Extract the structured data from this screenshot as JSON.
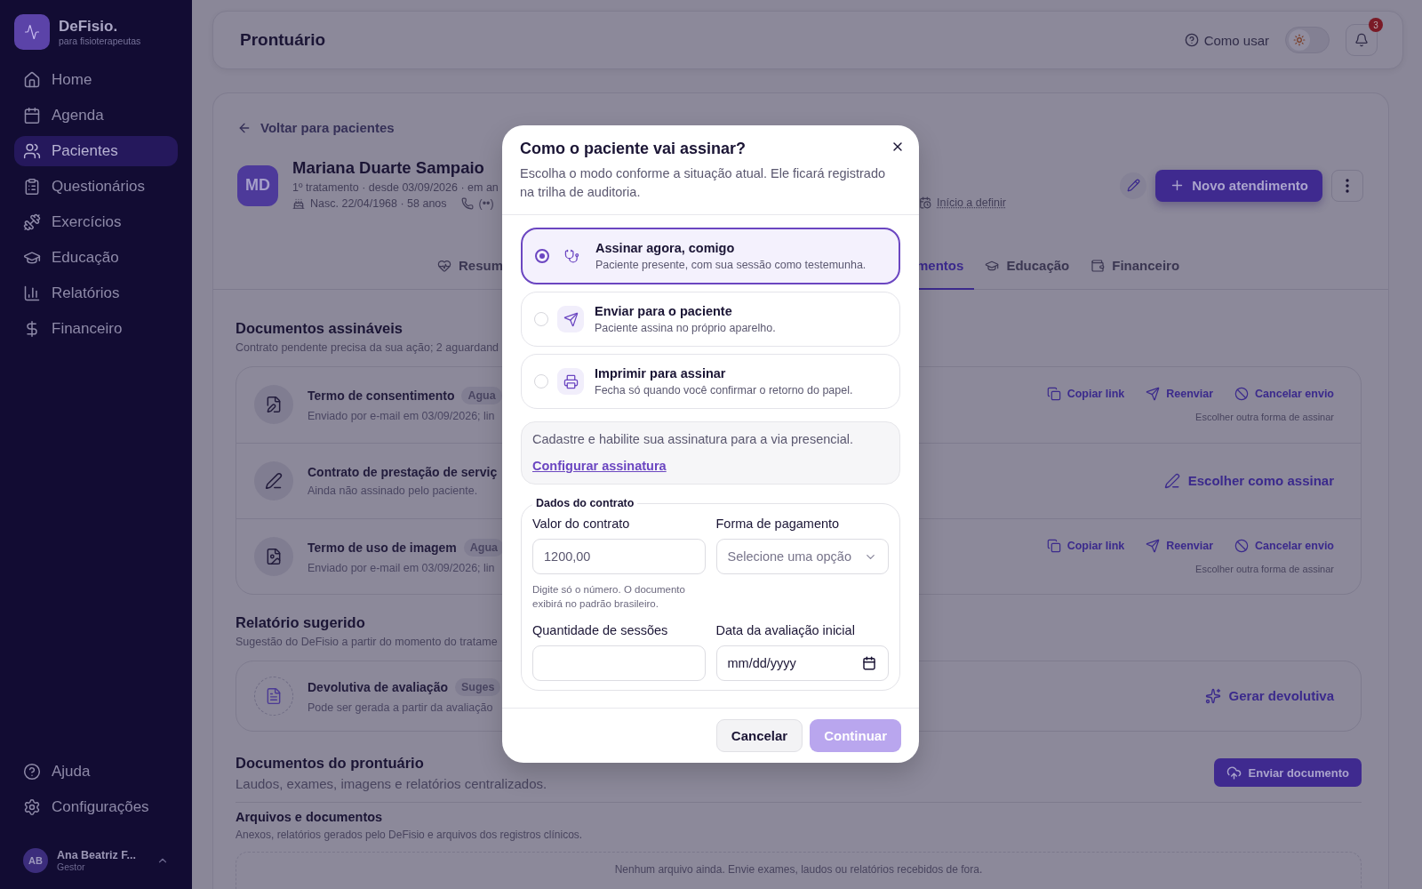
{
  "sidebar": {
    "brand": "DeFisio.",
    "tagline": "para fisioterapeutas",
    "items": [
      {
        "label": "Home",
        "selected": false
      },
      {
        "label": "Agenda",
        "selected": false
      },
      {
        "label": "Pacientes",
        "selected": true
      },
      {
        "label": "Questionários",
        "selected": false
      },
      {
        "label": "Exercícios",
        "selected": false
      },
      {
        "label": "Educação",
        "selected": false
      },
      {
        "label": "Relatórios",
        "selected": false
      },
      {
        "label": "Financeiro",
        "selected": false
      }
    ],
    "footer_items": [
      {
        "label": "Ajuda"
      },
      {
        "label": "Configurações"
      }
    ],
    "user": {
      "initials": "AB",
      "name": "Ana Beatriz F...",
      "role": "Gestor"
    }
  },
  "header": {
    "title": "Prontuário",
    "help": "Como usar",
    "dark_mode": false,
    "notifications": "3"
  },
  "patient": {
    "back": "Voltar para pacientes",
    "initials": "MD",
    "name": "Mariana Duarte Sampaio",
    "line1": "1º tratamento · desde 03/09/2026 · em an",
    "birth": "Nasc. 22/04/1968 · 58 anos",
    "phone": "(••)",
    "start": "Início a definir",
    "new_button": "Novo atendimento"
  },
  "tabs": [
    {
      "label": "Resum",
      "selected": false
    },
    {
      "label": "mentos",
      "selected": true
    },
    {
      "label": "Educação",
      "selected": false
    },
    {
      "label": "Financeiro",
      "selected": false
    }
  ],
  "signable": {
    "title": "Documentos assináveis",
    "subtitle": "Contrato pendente precisa da sua ação; 2 aguardand",
    "rows": [
      {
        "kind": "sent",
        "title": "Termo de consentimento",
        "badge": "Agua",
        "detail": "Enviado por e-mail em 03/09/2026; lin",
        "actions": [
          "Copiar link",
          "Reenviar",
          "Cancelar envio"
        ],
        "alt": "Escolher outra forma de assinar"
      },
      {
        "kind": "pending",
        "title": "Contrato de prestação de serviç",
        "detail": "Ainda não assinado pelo paciente.",
        "action": "Escolher como assinar"
      },
      {
        "kind": "sent",
        "title": "Termo de uso de imagem",
        "badge": "Agua",
        "detail": "Enviado por e-mail em 03/09/2026; lin",
        "actions": [
          "Copiar link",
          "Reenviar",
          "Cancelar envio"
        ],
        "alt": "Escolher outra forma de assinar"
      }
    ]
  },
  "suggested": {
    "title": "Relatório sugerido",
    "subtitle": "Sugestão do DeFisio a partir do momento do tratame",
    "row": {
      "title": "Devolutiva de avaliação",
      "badge": "Suges",
      "detail": "Pode ser gerada a partir da avaliação",
      "action": "Gerar devolutiva"
    }
  },
  "records": {
    "title": "Documentos do prontuário",
    "subtitle": "Laudos, exames, imagens e relatórios centralizados.",
    "upload": "Enviar documento",
    "files_title": "Arquivos e documentos",
    "files_subtitle": "Anexos, relatórios gerados pelo DeFisio e arquivos dos registros clínicos.",
    "empty": "Nenhum arquivo ainda. Envie exames, laudos ou relatórios recebidos de fora."
  },
  "modal": {
    "title": "Como o paciente vai assinar?",
    "description": "Escolha o modo conforme a situação atual. Ele ficará registrado na trilha de auditoria.",
    "options": [
      {
        "title": "Assinar agora, comigo",
        "detail": "Paciente presente, com sua sessão como testemunha.",
        "selected": true
      },
      {
        "title": "Enviar para o paciente",
        "detail": "Paciente assina no próprio aparelho.",
        "selected": false
      },
      {
        "title": "Imprimir para assinar",
        "detail": "Fecha só quando você confirmar o retorno do papel.",
        "selected": false
      }
    ],
    "notice": "Cadastre e habilite sua assinatura para a via presencial.",
    "notice_link": "Configurar assinatura",
    "legend": "Dados do contrato",
    "fields": [
      {
        "kind": "text",
        "label": "Valor do contrato",
        "value": "1200,00",
        "hint": "Digite só o número. O documento exibirá no padrão brasileiro."
      },
      {
        "kind": "select",
        "label": "Forma de pagamento",
        "placeholder": "Selecione uma opção"
      },
      {
        "kind": "text",
        "label": "Quantidade de sessões"
      },
      {
        "kind": "date",
        "label": "Data da avaliação inicial",
        "placeholder": "mm/dd/yyyy"
      }
    ],
    "cancel": "Cancelar",
    "submit": "Continuar",
    "submit_disabled": true
  }
}
